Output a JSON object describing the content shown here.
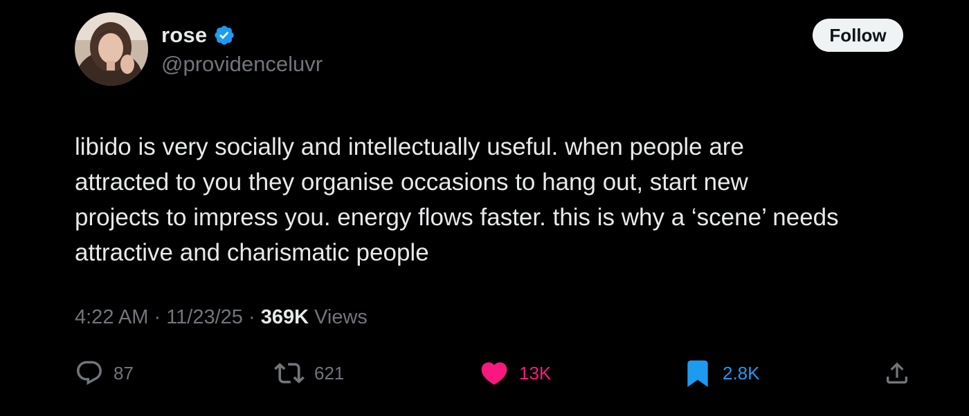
{
  "author": {
    "display_name": "rose",
    "handle": "@providenceluvr",
    "verified": true,
    "avatar_icon": "user-photo-avatar"
  },
  "follow_label": "Follow",
  "tweet": {
    "lines": [
      "libido is very socially and intellectually useful. when people are",
      "attracted to you they organise occasions to hang out, start new",
      "projects to impress you. energy flows faster. this is why a ‘scene’ needs",
      "attractive and charismatic people"
    ]
  },
  "meta": {
    "time": "4:22 AM",
    "date": "11/23/25",
    "views_count": "369K",
    "views_label": "Views"
  },
  "actions": {
    "reply": {
      "icon": "reply-bubble-icon",
      "count": "87"
    },
    "repost": {
      "icon": "repost-arrows-icon",
      "count": "621"
    },
    "like": {
      "icon": "heart-filled-icon",
      "count": "13K"
    },
    "bookmark": {
      "icon": "bookmark-filled-icon",
      "count": "2.8K"
    },
    "share": {
      "icon": "share-upload-icon"
    }
  },
  "colors": {
    "background": "#000000",
    "text_primary": "#e7e9ea",
    "text_secondary": "#71767b",
    "verified_blue": "#1d9bf0",
    "like_pink": "#f91880",
    "bookmark_blue": "#1d9bf0",
    "follow_bg": "#eff3f4"
  }
}
